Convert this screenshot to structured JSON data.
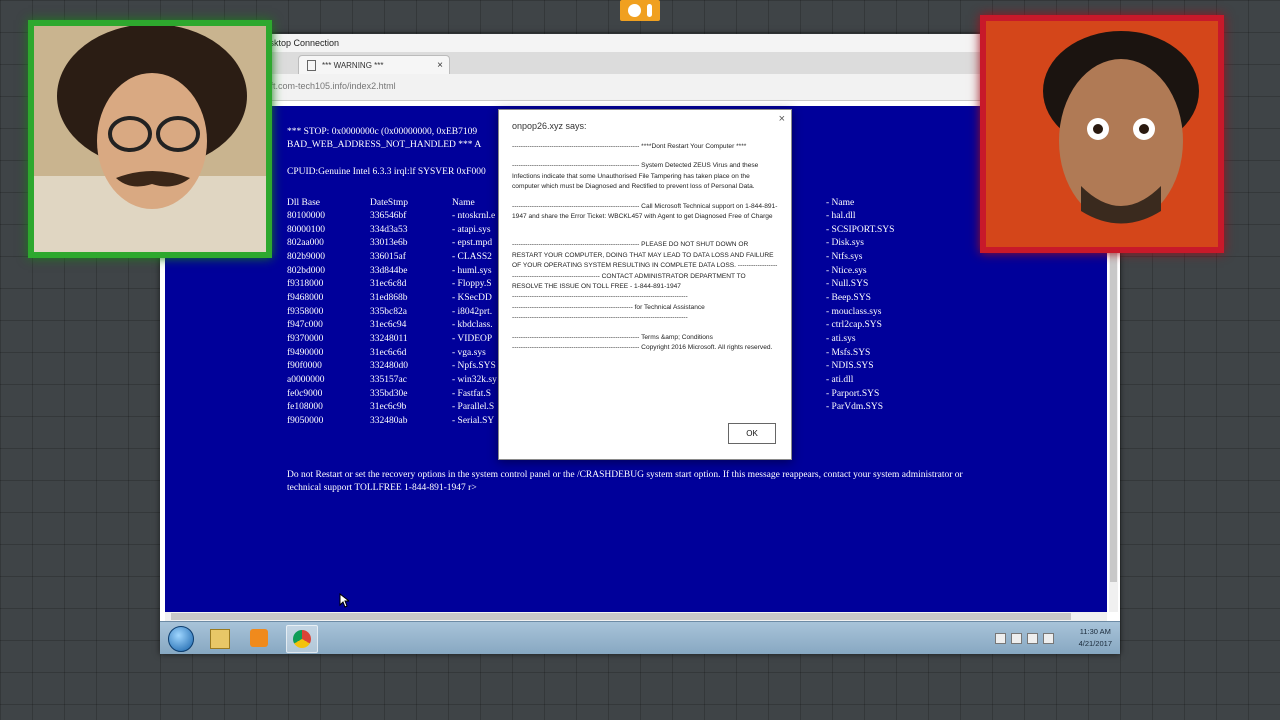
{
  "browser": {
    "window_title": "Desktop Connection",
    "tab_title": "*** WARNING ***",
    "url": "osoft.com-tech105.info/index2.html"
  },
  "bsod": {
    "line1": "*** STOP: 0x0000000c (0x00000000, 0xEB7109",
    "line2": "BAD_WEB_ADDRESS_NOT_HANDLED *** A",
    "line3": "CPUID:Genuine Intel 6.3.3 irql:lf SYSVER 0xF000",
    "headers": {
      "dll_base": "Dll Base",
      "date_stamp": "DateStmp",
      "name": "Name",
      "name2": "- Name"
    },
    "dll_base": [
      "80100000",
      "80000100",
      "802aa000",
      "802b9000",
      "802bd000",
      "f9318000",
      "f9468000",
      "f9358000",
      "f947c000",
      "f9370000",
      "f9490000",
      "f90f0000",
      "a0000000",
      "fe0c9000",
      "fe108000",
      "f9050000"
    ],
    "date_stamp": [
      "336546bf",
      "334d3a53",
      "33013e6b",
      "336015af",
      "33d844be",
      "31ec6c8d",
      "31ed868b",
      "335bc82a",
      "31ec6c94",
      "33248011",
      "31ec6c6d",
      "332480d0",
      "335157ac",
      "335bd30e",
      "31ec6c9b",
      "332480ab"
    ],
    "name_col": [
      "- ntoskrnl.e",
      "- atapi.sys",
      "- epst.mpd",
      "- CLASS2",
      "- huml.sys",
      "- Floppy.S",
      "- KSecDD",
      "- i8042prt.",
      "- kbdclass.",
      "- VIDEOP",
      "- vga.sys",
      "- Npfs.SYS",
      "- win32k.sy",
      "- Fastfat.S",
      "- Parallel.S",
      "- Serial.SY"
    ],
    "name_col2": [
      "- hal.dll",
      "- SCSIPORT.SYS",
      "- Disk.sys",
      "- Ntfs.sys",
      "- Ntice.sys",
      "- Null.SYS",
      "- Beep.SYS",
      "- mouclass.sys",
      "- ctrl2cap.SYS",
      "- ati.sys",
      "- Msfs.SYS",
      "- NDIS.SYS",
      "- ati.dll",
      "- Parport.SYS",
      "- ParVdm.SYS"
    ],
    "footer1": "Do not Restart or set the recovery options in the system control panel or the /CRASHDEBUG system start option. If this message reappears, contact your system administrator or",
    "footer2": "technical support TOLLFREE 1-844-891-1947 r>"
  },
  "dialog": {
    "title": "onpop26.xyz says:",
    "close": "×",
    "p1": "---------------------------------------------------------- ****Dont Restart Your Computer ****",
    "p2": "---------------------------------------------------------- System Detected ZEUS Virus and these Infections indicate that some Unauthorised File Tampering has taken place on the computer which must be Diagnosed and Rectified to prevent loss of Personal Data.",
    "p3": "---------------------------------------------------------- Call Microsoft Technical support on 1-844-891-1947 and share the Error Ticket: WBCKL457 with Agent to get Diagnosed Free of Charge",
    "p4": "---------------------------------------------------------- PLEASE DO NOT SHUT DOWN OR RESTART YOUR COMPUTER, DOING THAT MAY LEAD TO DATA LOSS AND FAILURE OF YOUR OPERATING SYSTEM RESULTING IN COMPLETE DATA LOSS. ---------------------------------------------------------- CONTACT ADMINISTRATOR DEPARTMENT TO RESOLVE THE ISSUE ON TOLL FREE - 1-844-891-1947",
    "p5": "--------------------------------------------------------------------------------",
    "p6": "------------------------------------------------------- for Technical Assistance",
    "p7": "--------------------------------------------------------------------------------",
    "p8": "---------------------------------------------------------- Terms &amp; Conditions",
    "p9": "---------------------------------------------------------- Copyright 2016 Microsoft. All rights reserved.",
    "ok_label": "OK"
  },
  "taskbar": {
    "apps": [
      "windows-start-icon",
      "file-explorer-icon",
      "media-player-icon",
      "chrome-icon"
    ],
    "time": "11:30 AM",
    "date": "4/21/2017"
  },
  "colors": {
    "bsod_blue": "#00009a",
    "cam_left_border": "#2ea82e",
    "cam_right_border": "#c8192a"
  }
}
